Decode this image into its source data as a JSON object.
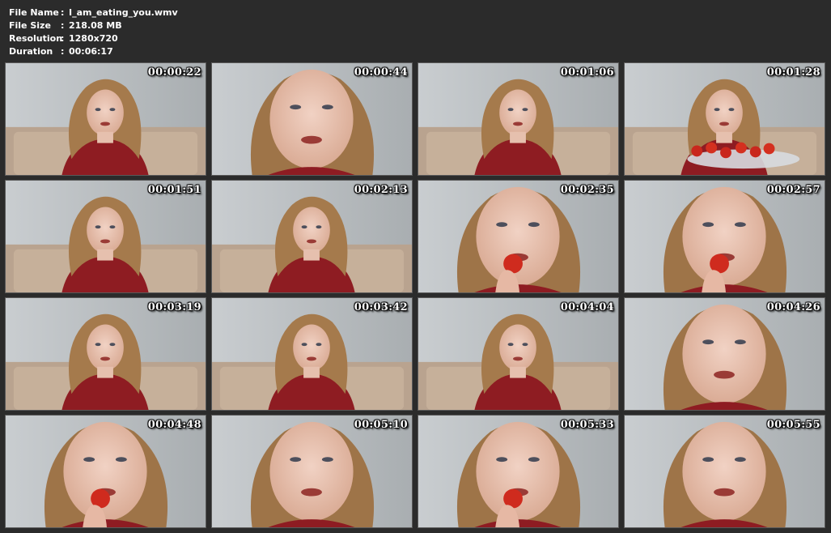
{
  "file_info": {
    "name_label": "File Name",
    "name_value": "I_am_eating_you.wmv",
    "size_label": "File Size",
    "size_value": "218.08 MB",
    "resolution_label": "Resolution",
    "resolution_value": "1280x720",
    "duration_label": "Duration",
    "duration_value": "00:06:17",
    "separator": ":"
  },
  "thumbnails": [
    {
      "timestamp": "00:00:22"
    },
    {
      "timestamp": "00:00:44"
    },
    {
      "timestamp": "00:01:06"
    },
    {
      "timestamp": "00:01:28"
    },
    {
      "timestamp": "00:01:51"
    },
    {
      "timestamp": "00:02:13"
    },
    {
      "timestamp": "00:02:35"
    },
    {
      "timestamp": "00:02:57"
    },
    {
      "timestamp": "00:03:19"
    },
    {
      "timestamp": "00:03:42"
    },
    {
      "timestamp": "00:04:04"
    },
    {
      "timestamp": "00:04:26"
    },
    {
      "timestamp": "00:04:48"
    },
    {
      "timestamp": "00:05:10"
    },
    {
      "timestamp": "00:05:33"
    },
    {
      "timestamp": "00:05:55"
    }
  ]
}
